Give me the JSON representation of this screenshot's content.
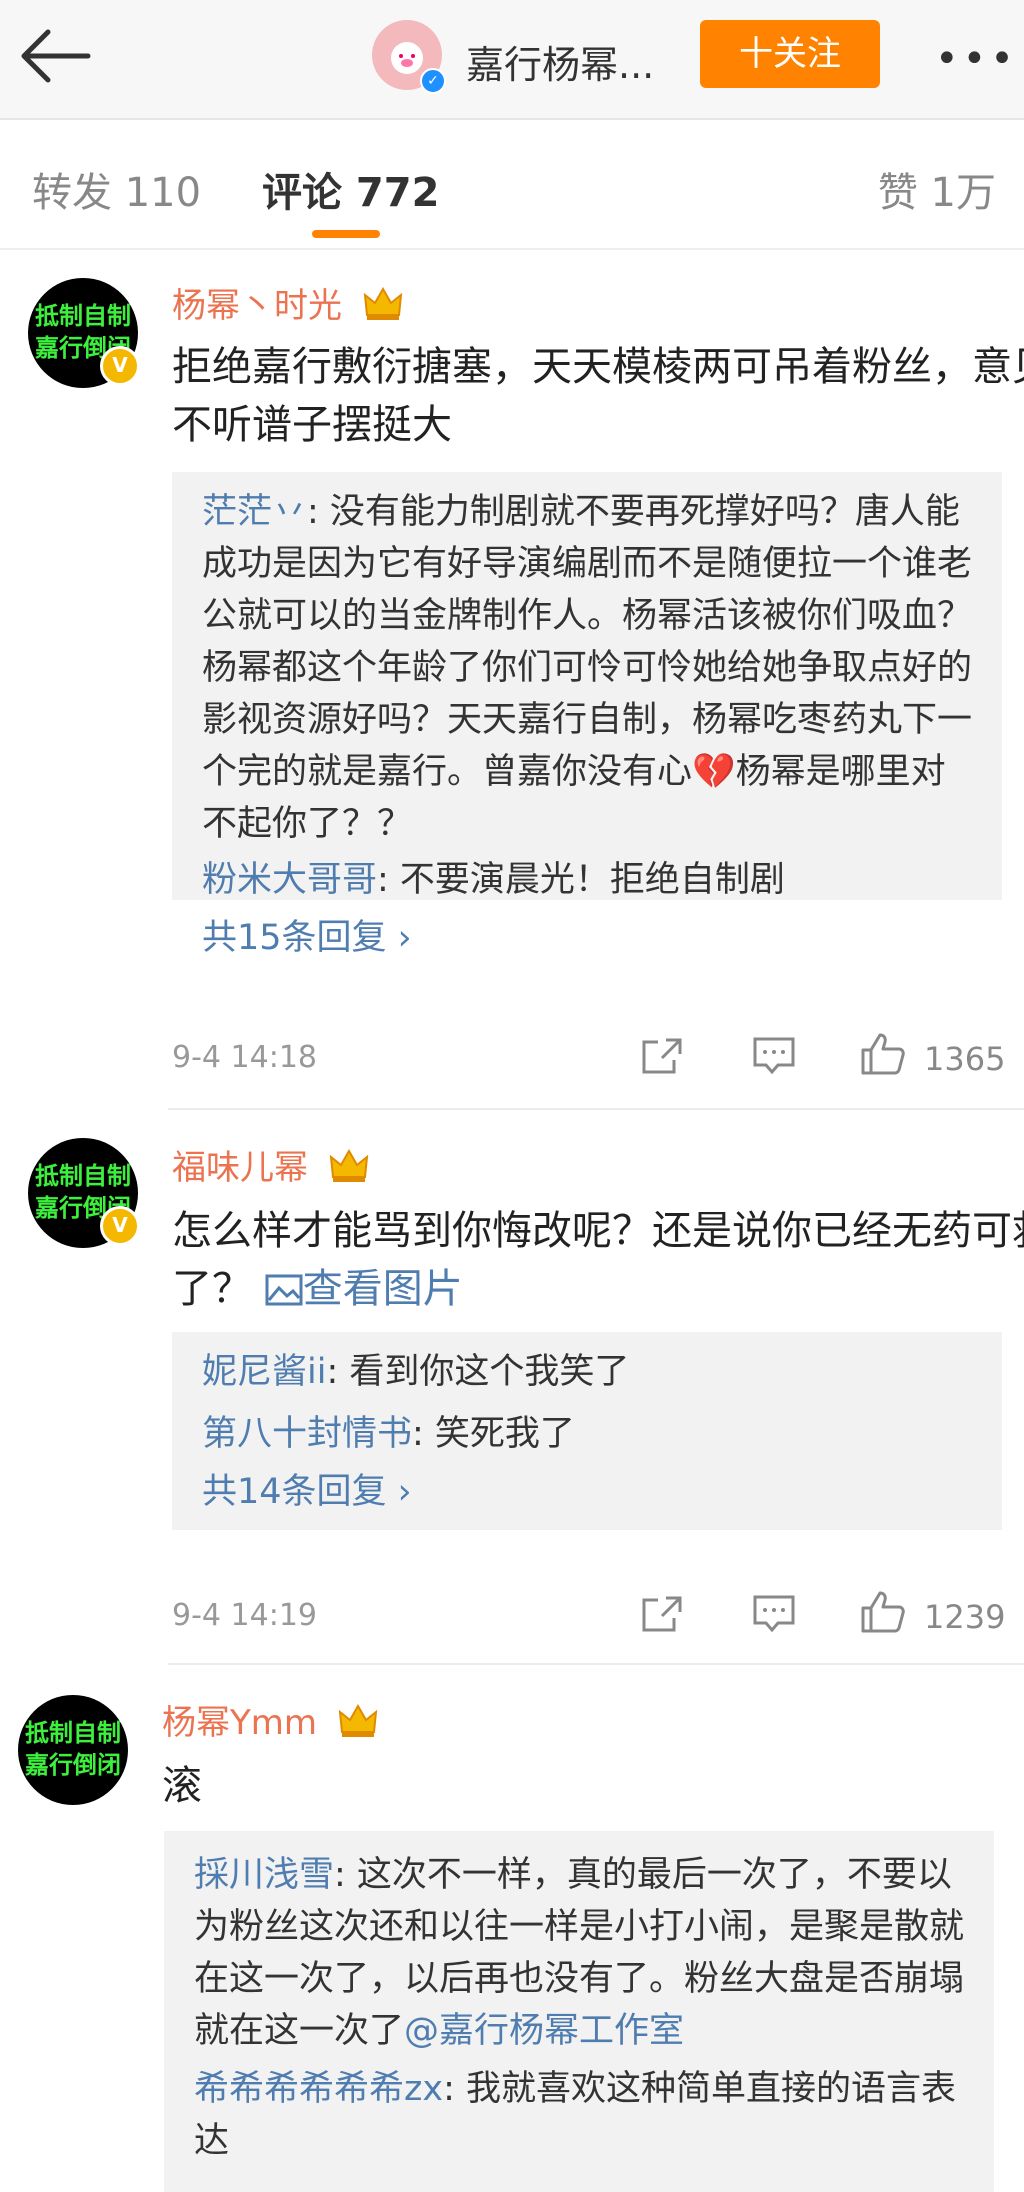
{
  "header": {
    "title": "嘉行杨幂...",
    "follow_label": "十关注",
    "more_label": "•••"
  },
  "tabs": {
    "repost": "转发 110",
    "comments": "评论 772",
    "likes": "赞 1万"
  },
  "avatar_text": [
    "抵制自制",
    "嘉行倒闭"
  ],
  "comments": [
    {
      "name": "杨幂丶时光",
      "text": "拒绝嘉行敷衍搪塞，天天模棱两可吊着粉丝，意见不听谱子摆挺大",
      "replies": [
        {
          "name": "茫茫丷",
          "text": ": 没有能力制剧就不要再死撑好吗？唐人能成功是因为它有好导演编剧而不是随便拉一个谁老公就可以的当金牌制作人。杨幂活该被你们吸血？杨幂都这个年龄了你们可怜可怜她给她争取点好的影视资源好吗？天天嘉行自制，杨幂吃枣药丸下一个完的就是嘉行。曾嘉你没有心💔杨幂是哪里对不起你了？？"
        },
        {
          "name": "粉米大哥哥",
          "text": ": 不要演晨光！拒绝自制剧"
        }
      ],
      "more_replies": "共15条回复 ›",
      "time": "9-4 14:18",
      "likes": "1365"
    },
    {
      "name": "福味儿幂",
      "text": "怎么样才能骂到你悔改呢？还是说你已经无药可救了？",
      "image_link": "查看图片",
      "replies": [
        {
          "name": "妮尼酱ii",
          "text": ": 看到你这个我笑了"
        },
        {
          "name": "第八十封情书",
          "text": ": 笑死我了"
        }
      ],
      "more_replies": "共14条回复 ›",
      "time": "9-4 14:19",
      "likes": "1239"
    },
    {
      "name": "杨幂Ymm",
      "text": "滚",
      "replies": [
        {
          "name": "採川浅雪",
          "text": ": 这次不一样，真的最后一次了，不要以为粉丝这次还和以往一样是小打小闹，是聚是散就在这一次了，以后再也没有了。粉丝大盘是否崩塌就在这一次了",
          "mention": "@嘉行杨幂工作室"
        },
        {
          "name": "希希希希希希zx",
          "text": ": 我就喜欢这种简单直接的语言表达"
        }
      ]
    }
  ]
}
